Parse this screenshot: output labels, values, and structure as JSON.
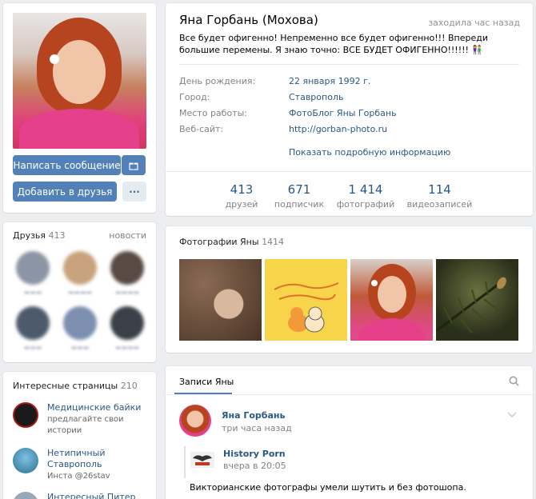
{
  "profile": {
    "name": "Яна Горбань (Мохова)",
    "last_seen": "заходила час назад",
    "status": "Все будет офигенно! Непременно все будет офигенно!!! Впереди большие перемены. Я знаю точно: ВСЕ БУДЕТ ОФИГЕННО!!!!!!",
    "status_emoji": "👫",
    "info": [
      {
        "label": "День рождения:",
        "value": "22 января 1992 г."
      },
      {
        "label": "Город:",
        "value": "Ставрополь"
      },
      {
        "label": "Место работы:",
        "value": "ФотоБлог Яны Горбань"
      },
      {
        "label": "Веб-сайт:",
        "value": "http://gorban-photo.ru"
      }
    ],
    "show_more": "Показать подробную информацию",
    "counters": [
      {
        "num": "413",
        "label": "друзей"
      },
      {
        "num": "671",
        "label": "подписчик"
      },
      {
        "num": "1 414",
        "label": "фотографий"
      },
      {
        "num": "114",
        "label": "видеозаписей"
      }
    ]
  },
  "actions": {
    "message": "Написать сообщение",
    "gift_icon": "gift-icon",
    "add_friend": "Добавить в друзья",
    "more": "···"
  },
  "friends": {
    "title": "Друзья",
    "count": "413",
    "link": "новости"
  },
  "photos": {
    "title": "Фотографии Яны",
    "count": "1414"
  },
  "pages": {
    "title": "Интересные страницы",
    "count": "210",
    "items": [
      {
        "title": "Медицинские байки",
        "desc": "предлагайте свои истории"
      },
      {
        "title": "Нетипичный Ставрополь",
        "desc": "Инста @26stav"
      },
      {
        "title": "Интересный Питер",
        "desc": ""
      }
    ]
  },
  "wall": {
    "tab": "Записи Яны",
    "author": "Яна Горбань",
    "time": "три часа назад",
    "repost_author": "History Porn",
    "repost_time": "вчера в 20:05",
    "text": "Викторианские фотографы умели шутить и без фотошопа."
  },
  "colors": {
    "accent": "#5181b8",
    "link": "#2a5885",
    "background": "#edeef0"
  }
}
